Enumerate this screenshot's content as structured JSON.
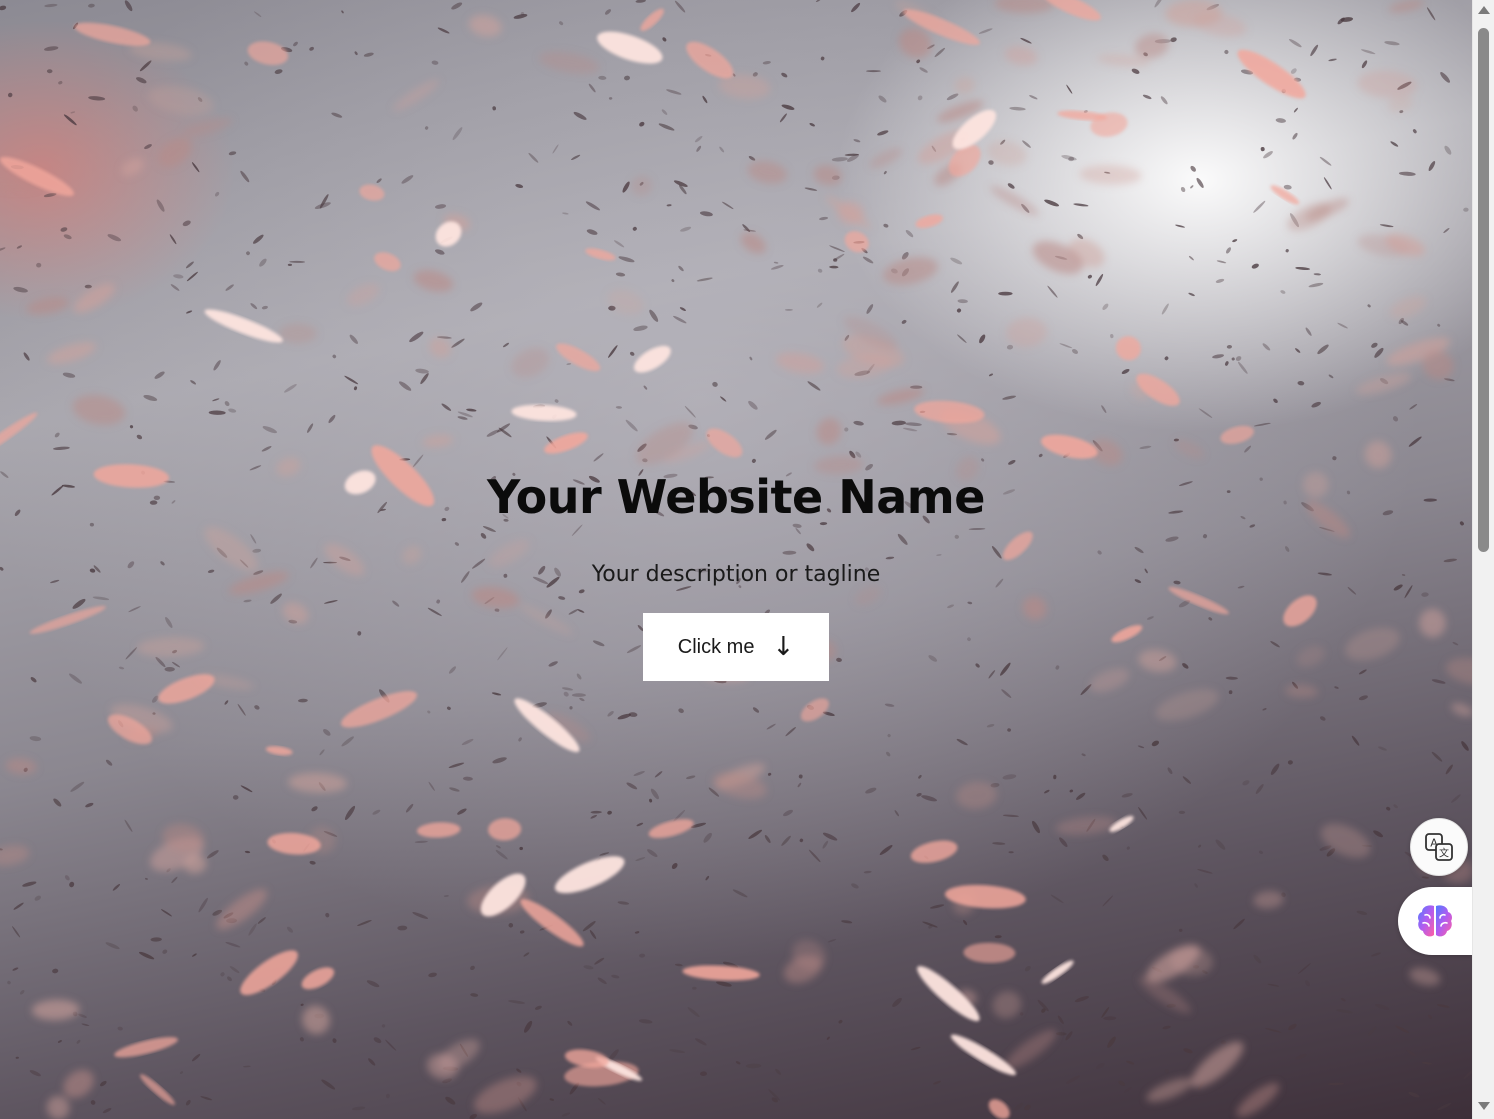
{
  "hero": {
    "title": "Your Website Name",
    "tagline": "Your description or tagline",
    "button_label": "Click me",
    "button_arrow": "↓"
  },
  "floating_actions": {
    "translate_icon": "translate-icon",
    "ai_icon": "brain-icon"
  },
  "colors": {
    "petal": "#f2a79c",
    "petal_bright": "#fde4df",
    "debris": "#4a3a40",
    "title_text": "#0b0b0b",
    "button_bg": "#ffffff"
  }
}
